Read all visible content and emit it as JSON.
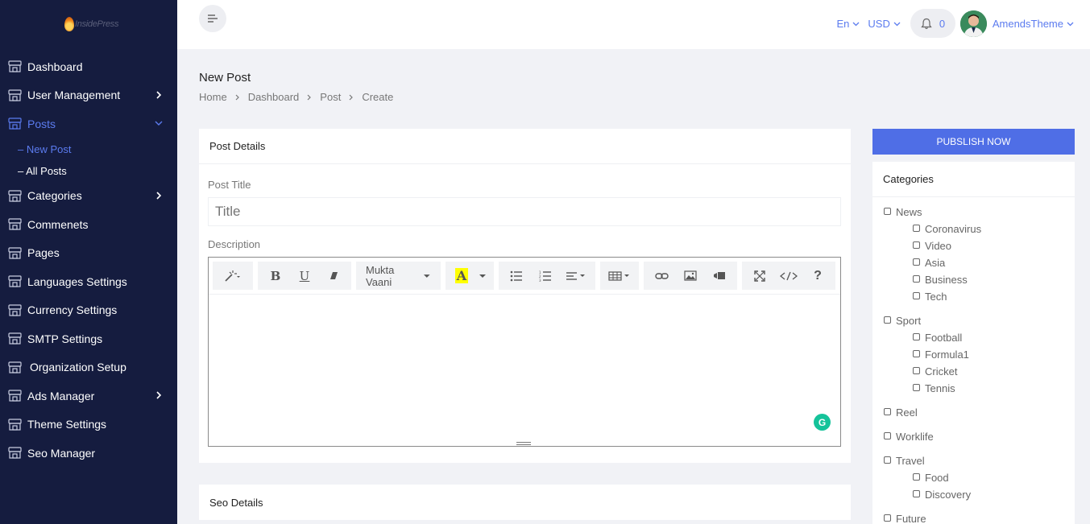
{
  "logo": {
    "text": "InsidePress"
  },
  "sidebar": {
    "items": [
      {
        "label": "Dashboard"
      },
      {
        "label": "User Management"
      },
      {
        "label": "Posts"
      },
      {
        "label": "Categories"
      },
      {
        "label": "Commenets"
      },
      {
        "label": "Pages"
      },
      {
        "label": "Languages Settings"
      },
      {
        "label": "Currency Settings"
      },
      {
        "label": "SMTP Settings"
      },
      {
        "label": "Organization Setup"
      },
      {
        "label": "Ads Manager"
      },
      {
        "label": "Theme Settings"
      },
      {
        "label": "Seo Manager"
      }
    ],
    "posts_sub": [
      {
        "label": "– New Post"
      },
      {
        "label": "– All Posts"
      }
    ]
  },
  "header": {
    "language": "En",
    "currency": "USD",
    "notification_count": "0",
    "user_name": "AmendsTheme"
  },
  "page": {
    "title": "New Post",
    "breadcrumb": [
      "Home",
      "Dashboard",
      "Post",
      "Create"
    ]
  },
  "post_details": {
    "heading": "Post Details",
    "title_label": "Post Title",
    "title_placeholder": "Title",
    "description_label": "Description",
    "font_name": "Mukta Vaani"
  },
  "seo_details": {
    "heading": "Seo Details"
  },
  "publish": {
    "label": "PUBSLISH NOW"
  },
  "categories": {
    "heading": "Categories",
    "groups": [
      {
        "name": "News",
        "children": [
          "Coronavirus",
          "Video",
          "Asia",
          "Business",
          "Tech"
        ]
      },
      {
        "name": "Sport",
        "children": [
          "Football",
          "Formula1",
          "Cricket",
          "Tennis"
        ]
      },
      {
        "name": "Reel",
        "children": []
      },
      {
        "name": "Worklife",
        "children": []
      },
      {
        "name": "Travel",
        "children": [
          "Food",
          "Discovery"
        ]
      },
      {
        "name": "Future",
        "children": []
      }
    ]
  },
  "colors": {
    "sidebar_bg": "#151c3f",
    "accent": "#5b7bef",
    "publish_bg": "#4f6ee6",
    "grammarly": "#15c39a"
  }
}
